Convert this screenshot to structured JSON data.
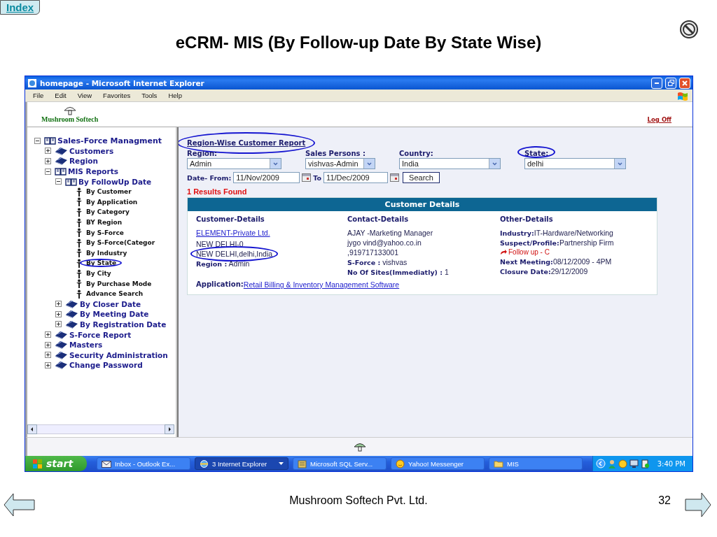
{
  "slide": {
    "index_button": "Index",
    "title": "eCRM- MIS (By Follow-up Date By State Wise)",
    "footer": "Mushroom Softech Pvt. Ltd.",
    "page_number": "32"
  },
  "window": {
    "title": "homepage - Microsoft Internet Explorer",
    "menu": [
      "File",
      "Edit",
      "View",
      "Favorites",
      "Tools",
      "Help"
    ]
  },
  "site": {
    "logo": "Mushroom Softech",
    "logoff": "Log Off"
  },
  "tree": [
    {
      "label": "Sales-Force Managment",
      "kind": "book",
      "expanded": true,
      "children": [
        {
          "label": "Customers",
          "kind": "closed-book",
          "expanded": false
        },
        {
          "label": "Region",
          "kind": "closed-book",
          "expanded": false
        },
        {
          "label": "MIS Reports",
          "kind": "book",
          "expanded": true,
          "children": [
            {
              "label": "By FollowUp Date",
              "kind": "book",
              "expanded": true,
              "children": [
                {
                  "label": "By Customer",
                  "kind": "leaf",
                  "circled": false
                },
                {
                  "label": "By Application",
                  "kind": "leaf",
                  "circled": false
                },
                {
                  "label": "By Category",
                  "kind": "leaf",
                  "circled": false
                },
                {
                  "label": "BY Region",
                  "kind": "leaf",
                  "circled": false
                },
                {
                  "label": "By S-Force",
                  "kind": "leaf",
                  "circled": false
                },
                {
                  "label": "By S-Force(Categor",
                  "kind": "leaf",
                  "circled": false
                },
                {
                  "label": "By Industry",
                  "kind": "leaf",
                  "circled": false
                },
                {
                  "label": "By State",
                  "kind": "leaf",
                  "circled": true
                },
                {
                  "label": "By City",
                  "kind": "leaf",
                  "circled": false
                },
                {
                  "label": "By Purchase Mode",
                  "kind": "leaf",
                  "circled": false
                },
                {
                  "label": "Advance Search",
                  "kind": "leaf",
                  "circled": false
                }
              ]
            },
            {
              "label": "By Closer Date",
              "kind": "closed-book",
              "expanded": false
            },
            {
              "label": "By Meeting Date",
              "kind": "closed-book",
              "expanded": false
            },
            {
              "label": "By Registration Date",
              "kind": "closed-book",
              "expanded": false
            }
          ]
        },
        {
          "label": "S-Force Report",
          "kind": "closed-book",
          "expanded": false
        },
        {
          "label": "Masters",
          "kind": "closed-book",
          "expanded": false
        },
        {
          "label": "Security Administration",
          "kind": "closed-book",
          "expanded": false
        },
        {
          "label": "Change Password",
          "kind": "closed-book",
          "expanded": false
        }
      ]
    }
  ],
  "report": {
    "title": {
      "text": "Region-Wise Customer Report",
      "circled": true
    },
    "filters": [
      {
        "label": "Region:",
        "value": "Admin",
        "circled": false
      },
      {
        "label": "Sales Persons :",
        "value": "vishvas-Admin",
        "circled": false
      },
      {
        "label": "Country:",
        "value": "India",
        "circled": false
      },
      {
        "label": "State:",
        "value": "delhi",
        "circled": true
      }
    ],
    "date_from_label": "Date- From:",
    "date_from": "11/Nov/2009",
    "date_to_label": "To",
    "date_to": "11/Dec/2009",
    "search_button": "Search",
    "results": "1 Results Found",
    "table_title": "Customer Details",
    "columns": [
      {
        "heading": "Customer-Details",
        "lines": [
          {
            "kind": "link",
            "text": "ELEMENT-Private Ltd.",
            "circled": false
          },
          {
            "kind": "text",
            "text": "NEW DELHI-0",
            "circled": false
          },
          {
            "kind": "text",
            "text": "NEW DELHI,delhi,India",
            "circled": true
          },
          {
            "kind": "text",
            "text": "**Region :** Admin",
            "circled": false
          }
        ]
      },
      {
        "heading": "Contact-Details",
        "lines": [
          {
            "kind": "text",
            "text": "AJAY -Marketing Manager"
          },
          {
            "kind": "text",
            "text": "jygo vind@yahoo.co.in"
          },
          {
            "kind": "text",
            "text": ",919717133001"
          },
          {
            "kind": "text",
            "text": "**S-Force :** vishvas"
          },
          {
            "kind": "text",
            "text": "**No Of Sites(Immediatly) :** 1"
          }
        ]
      },
      {
        "heading": "Other-Details",
        "lines": [
          {
            "kind": "text",
            "text": "**Industry:**IT-Hardware/Networking"
          },
          {
            "kind": "text",
            "text": "**Suspect/Profile:**Partnership Firm"
          },
          {
            "kind": "follow-up",
            "text": "Follow up - C"
          },
          {
            "kind": "text",
            "text": "**Next Meeting:**08/12/2009 - 4PM"
          },
          {
            "kind": "text",
            "text": "**Closure Date:**29/12/2009"
          }
        ]
      }
    ],
    "application_label": "Application:",
    "application": "Retail Billing & Inventory Management Software"
  },
  "taskbar": {
    "start": "start",
    "tasks": [
      {
        "label": "Inbox - Outlook Ex...",
        "kind": "mail",
        "selected": false
      },
      {
        "label": "3 Internet Explorer",
        "kind": "browser",
        "selected": true
      },
      {
        "label": "Microsoft SQL Serv...",
        "kind": "database",
        "selected": false
      },
      {
        "label": "Yahoo! Messenger",
        "kind": "messenger",
        "selected": false
      },
      {
        "label": "MIS",
        "kind": "folder",
        "selected": false
      }
    ],
    "clock": "3:40 PM"
  }
}
